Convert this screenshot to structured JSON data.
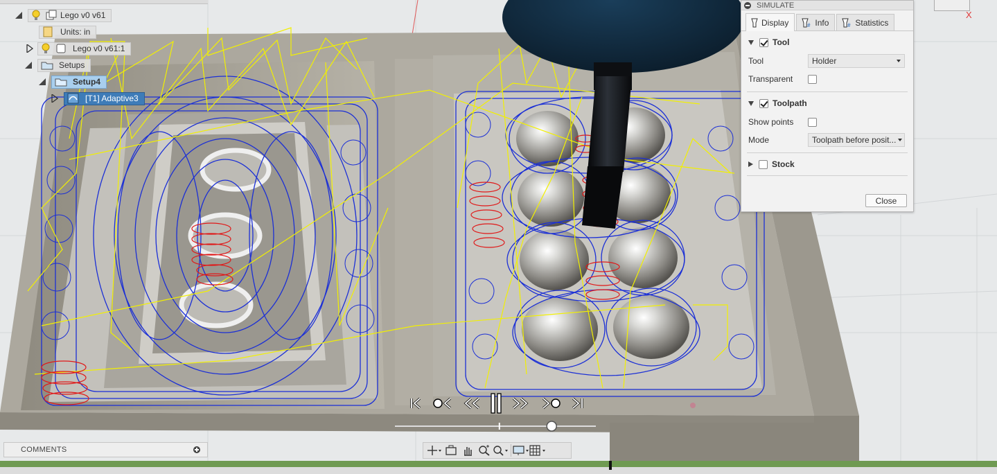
{
  "browser": {
    "items": [
      {
        "label": "Lego v0 v61",
        "icon": "component-icon",
        "level": 0
      },
      {
        "label": "Units: in",
        "icon": "document-icon",
        "level": 1
      },
      {
        "label": "Lego v0 v61:1",
        "icon": "body-icon",
        "level": 1
      },
      {
        "label": "Setups",
        "icon": "folder-icon",
        "level": 1
      },
      {
        "label": "Setup4",
        "icon": "setup-folder-icon",
        "level": 2
      },
      {
        "label": "[T1] Adaptive3",
        "icon": "toolpath-icon",
        "level": 3
      }
    ]
  },
  "simulate": {
    "title": "SIMULATE",
    "tabs": [
      {
        "label": "Display",
        "icon": "display-icon"
      },
      {
        "label": "Info",
        "icon": "info-icon"
      },
      {
        "label": "Statistics",
        "icon": "statistics-icon"
      }
    ],
    "tool": {
      "heading": "Tool",
      "tool_label": "Tool",
      "tool_value": "Holder",
      "transparent_label": "Transparent"
    },
    "toolpath": {
      "heading": "Toolpath",
      "show_points_label": "Show points",
      "mode_label": "Mode",
      "mode_value": "Toolpath before posit..."
    },
    "stock": {
      "heading": "Stock"
    },
    "close_label": "Close"
  },
  "comments": {
    "label": "COMMENTS"
  },
  "viewcube": {
    "axis_label": "X"
  },
  "colors": {
    "toolpath_blue": "#1b2fd6",
    "rapid_yellow": "#f2f000",
    "plunge_red": "#e01818",
    "stock": "#9e9a8f",
    "selection": "#a9cfee",
    "timeline_green": "#6f9a52"
  },
  "playback": {
    "progress": 0.78,
    "marker": 0.52
  }
}
